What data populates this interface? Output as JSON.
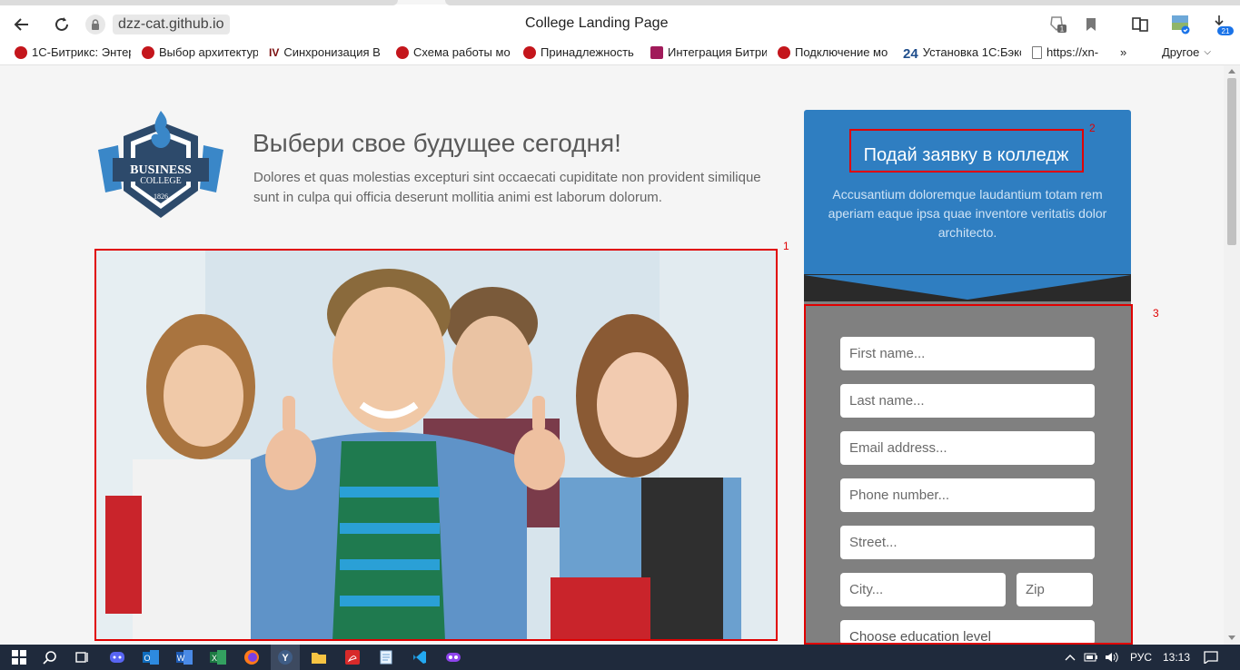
{
  "browser": {
    "url": "dzz-cat.github.io",
    "page_title": "College Landing Page",
    "notification_count": "1",
    "downloads_count": "21"
  },
  "bookmarks": [
    {
      "label": "1С-Битрикс: Энтер",
      "icon": "bitrix-icon"
    },
    {
      "label": "Выбор архитектур",
      "icon": "bitrix-icon"
    },
    {
      "label": "Синхронизация В",
      "icon": "iv-icon"
    },
    {
      "label": "Схема работы мо",
      "icon": "bitrix-icon"
    },
    {
      "label": "Принадлежность",
      "icon": "bitrix-icon"
    },
    {
      "label": "Интеграция Битри",
      "icon": "square-icon"
    },
    {
      "label": "Подключение мо",
      "icon": "red-circle-icon"
    },
    {
      "label": "Установка 1С:Бэкс",
      "icon": "24-icon"
    },
    {
      "label": "https://xn-",
      "icon": "document-icon"
    }
  ],
  "bookmarks_more": "»",
  "bookmarks_other": "Другое",
  "hero": {
    "title": "Выбери свое будущее сегодня!",
    "text": "Dolores et quas molestias excepturi sint occaecati cupiditate non provident similique sunt in culpa qui officia deserunt mollitia animi est laborum dolorum."
  },
  "logo": {
    "line1": "BUSINESS",
    "line2": "COLLEGE",
    "year": "1826"
  },
  "sidebar": {
    "title": "Подай заявку в колледж",
    "text": "Accusantium doloremque laudantium totam rem aperiam eaque ipsa quae inventore veritatis dolor architecto."
  },
  "form": {
    "first_name": "First name...",
    "last_name": "Last name...",
    "email": "Email address...",
    "phone": "Phone number...",
    "street": "Street...",
    "city": "City...",
    "zip": "Zip",
    "education": "Choose education level"
  },
  "annotations": {
    "n1": "1",
    "n2": "2",
    "n3": "3"
  },
  "colors": {
    "accent_blue": "#2f7ec1",
    "highlight_red": "#e00000",
    "form_gray": "#808080"
  },
  "taskbar": {
    "language": "РУС",
    "time": "13:13"
  }
}
